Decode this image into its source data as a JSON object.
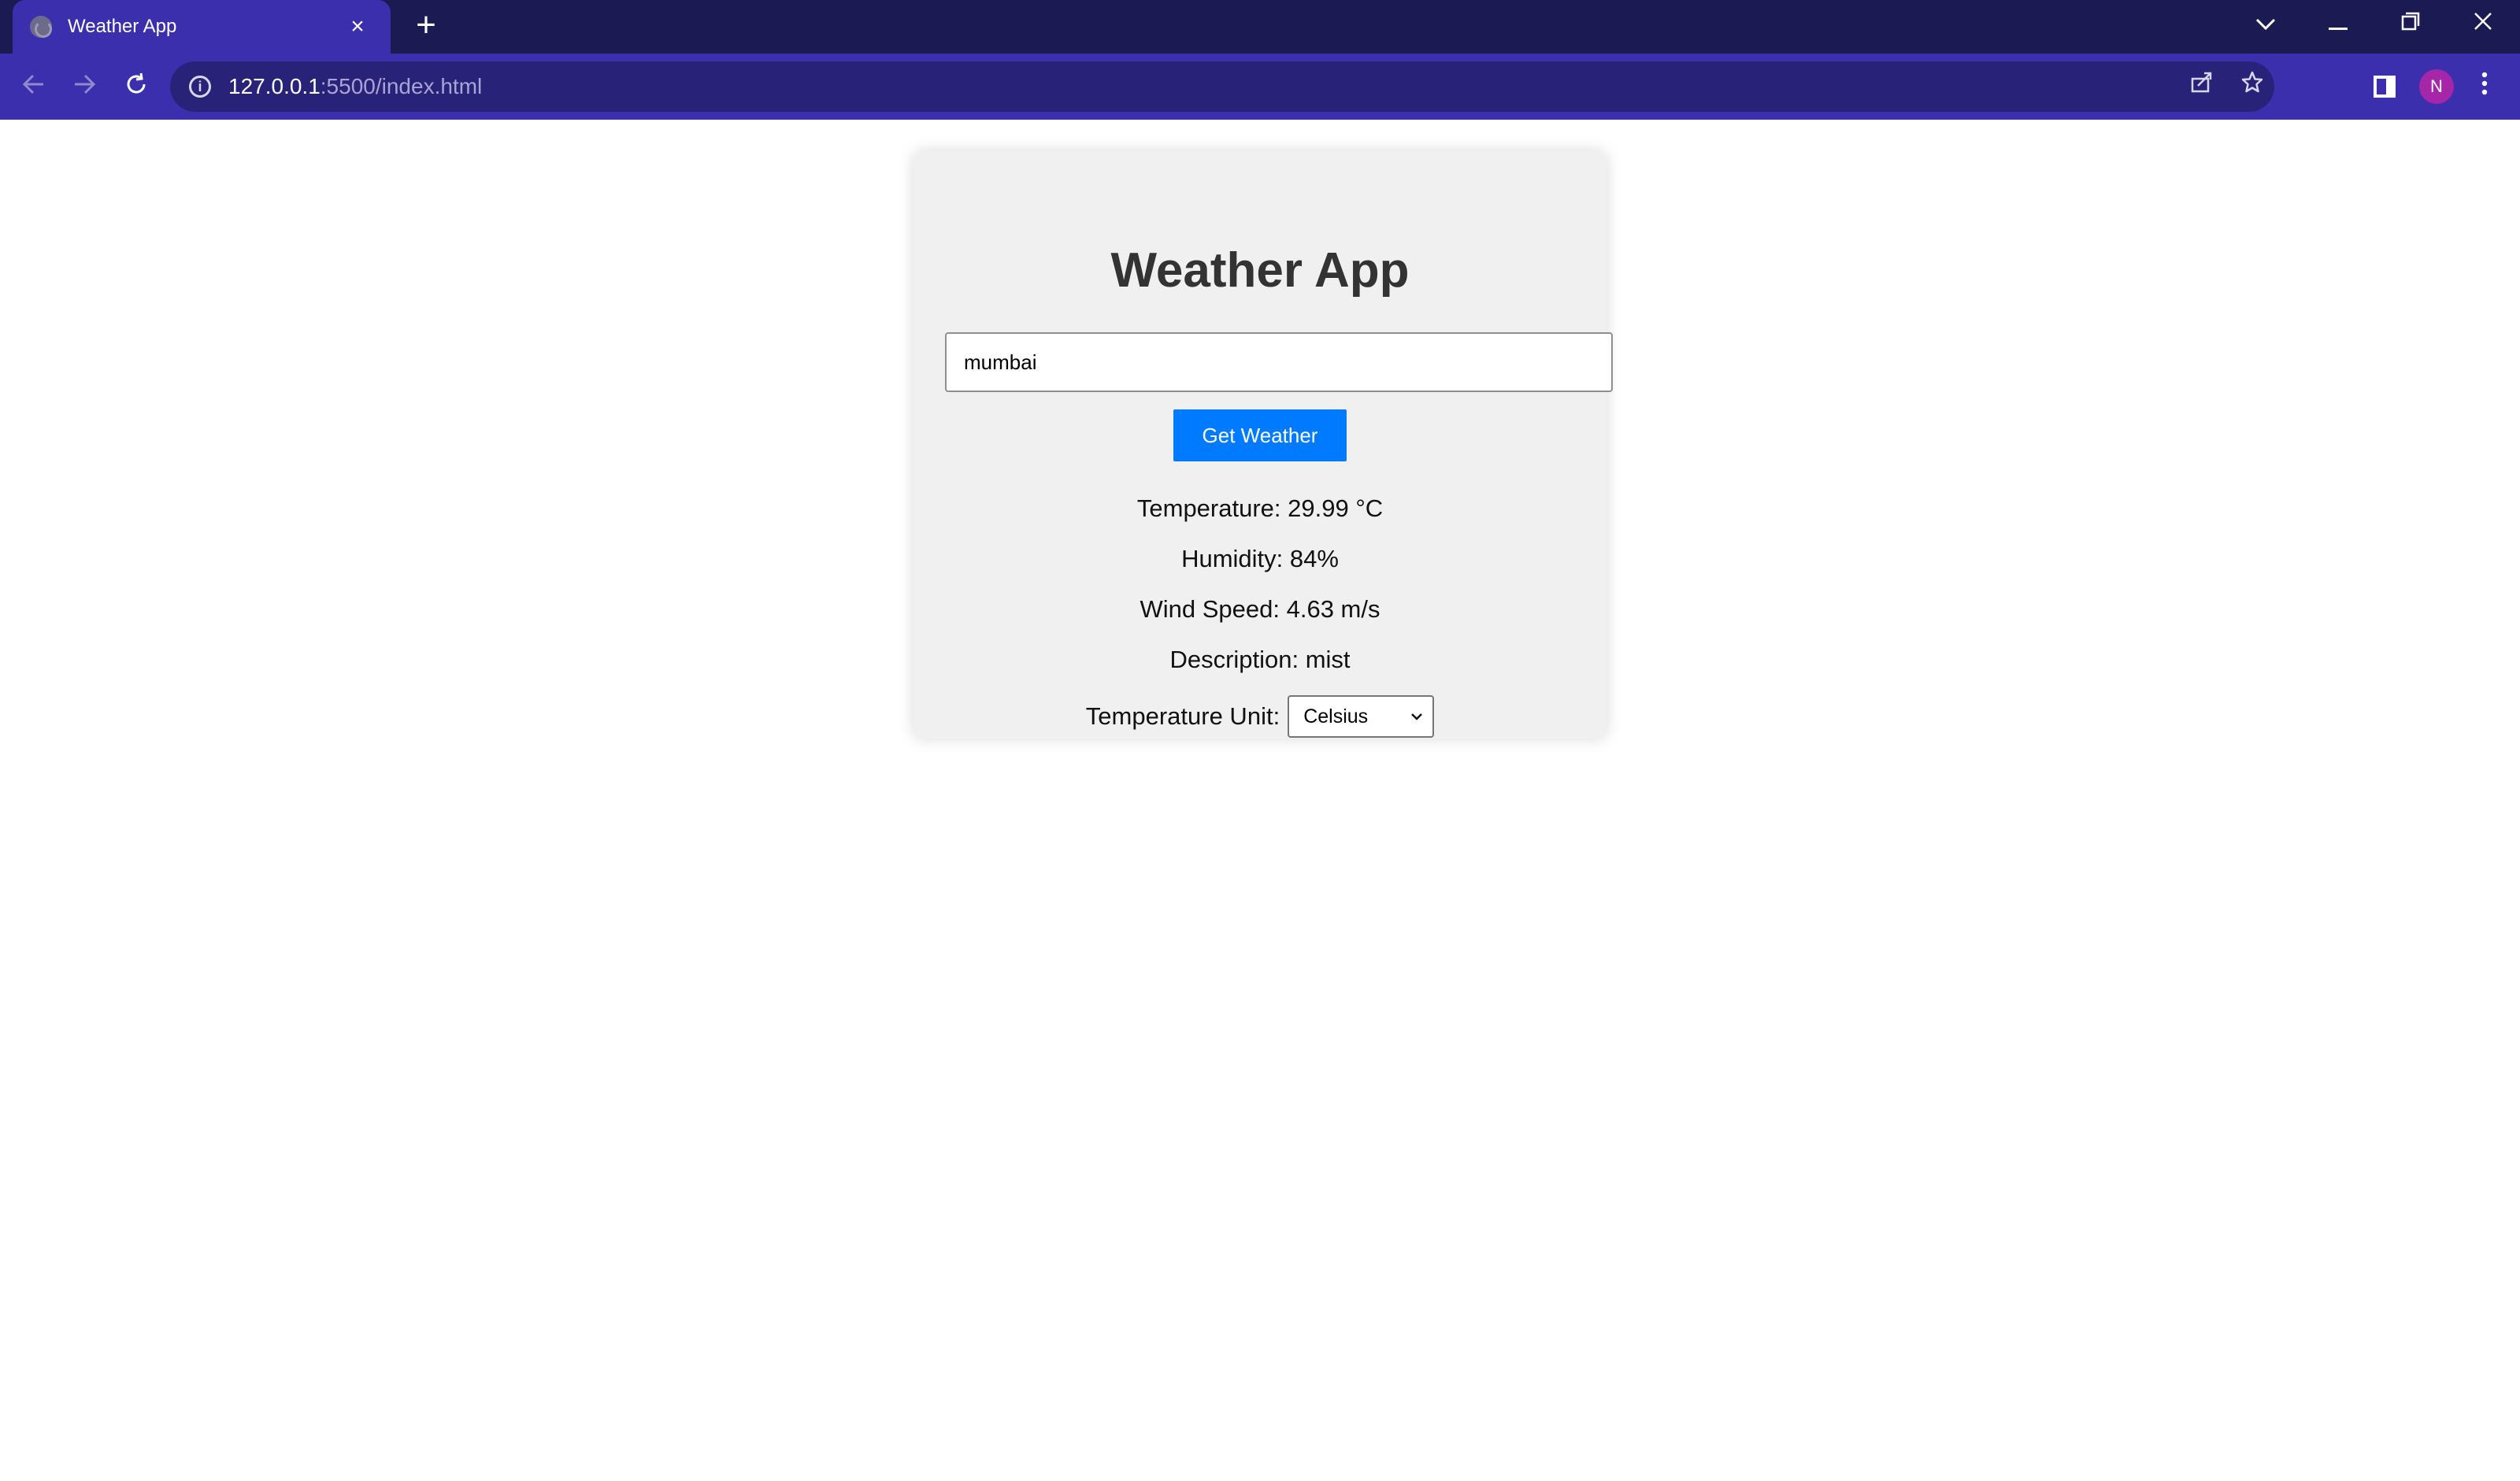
{
  "browser": {
    "tab_title": "Weather App",
    "tab_close": "×",
    "new_tab": "+",
    "url_host": "127.0.0.1",
    "url_path": ":5500/index.html",
    "profile_initial": "N"
  },
  "app": {
    "title": "Weather App",
    "city_input_value": "mumbai",
    "get_weather_label": "Get Weather",
    "temperature": "Temperature: 29.99 °C",
    "humidity": "Humidity: 84%",
    "wind_speed": "Wind Speed: 4.63 m/s",
    "description": "Description: mist",
    "unit_label": "Temperature Unit:",
    "unit_selected": "Celsius"
  },
  "colors": {
    "tabstrip": "#1c1a52",
    "toolbar": "#3b2fae",
    "omnibox": "#282378",
    "button": "#007bff",
    "card": "#f0f0f0",
    "avatar": "#a526a8"
  }
}
